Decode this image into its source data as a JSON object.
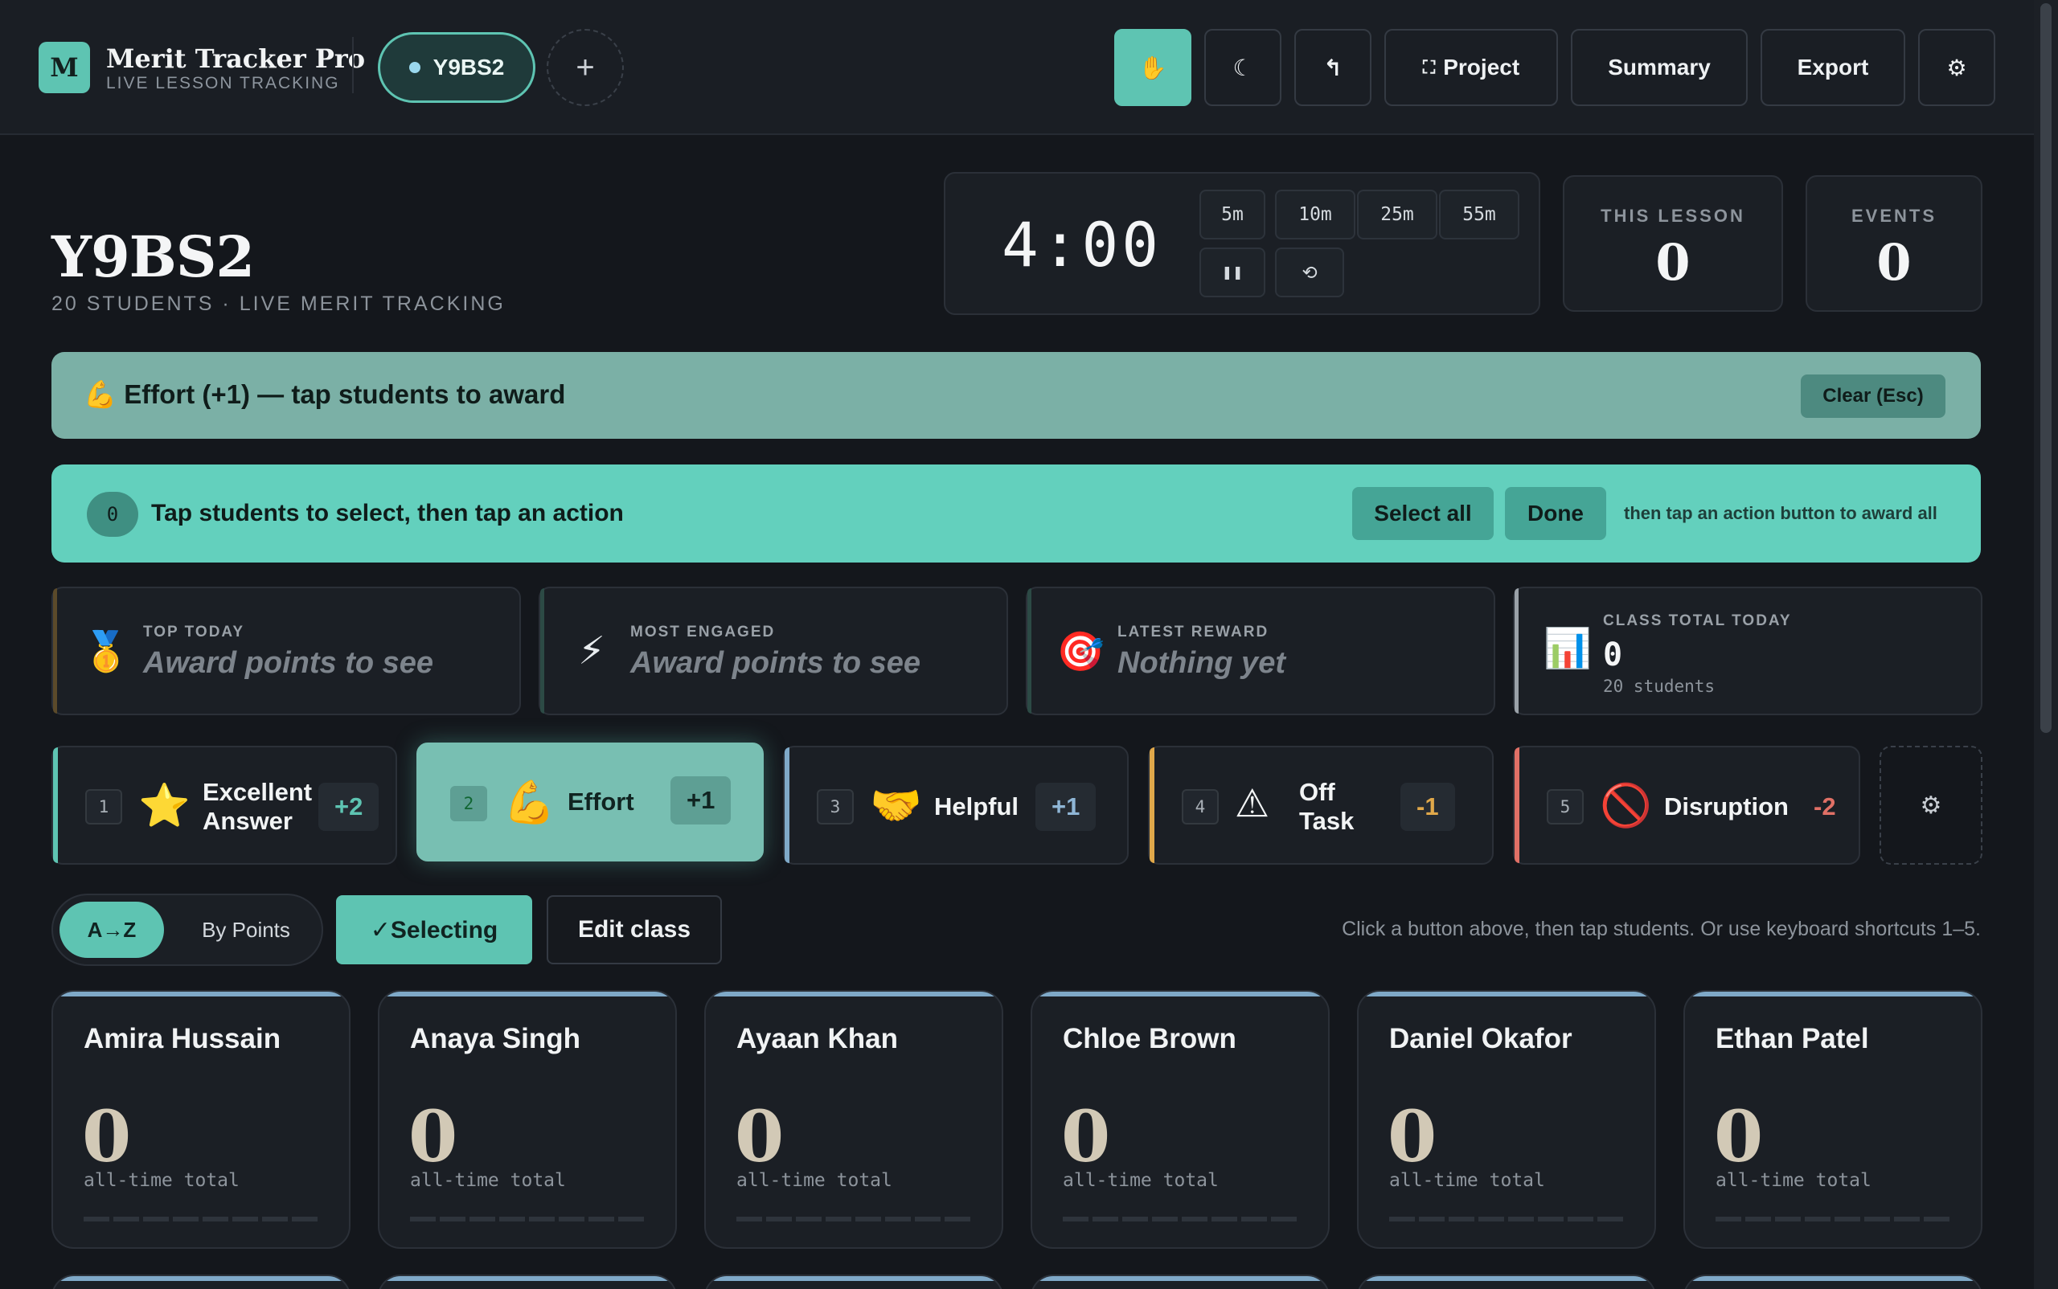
{
  "app": {
    "logo_letter": "M",
    "title": "Merit Tracker Pro",
    "subtitle": "LIVE LESSON TRACKING",
    "class_tab": "Y9BS2",
    "add_class_icon": "plus-icon"
  },
  "toolbar": {
    "hand_icon": "✋",
    "moon_icon": "☾",
    "undo_icon": "↰",
    "project_icon": "⛶",
    "project_label": "Project",
    "summary_label": "Summary",
    "export_label": "Export",
    "settings_icon": "⚙"
  },
  "heading": {
    "title": "Y9BS2",
    "subtitle": "20 STUDENTS · LIVE MERIT TRACKING"
  },
  "timer": {
    "display": "4:00",
    "presets": [
      "5m",
      "10m",
      "25m",
      "55m"
    ],
    "pause_icon": "❚❚",
    "reset_icon": "⟲"
  },
  "stats": {
    "this_lesson_label": "THIS LESSON",
    "this_lesson_value": "0",
    "events_label": "EVENTS",
    "events_value": "0"
  },
  "active_banner": {
    "text": "💪 Effort (+1) — tap students to award",
    "clear_label": "Clear (Esc)"
  },
  "select_banner": {
    "count": "0",
    "text": "Tap students to select, then tap an action",
    "select_all_label": "Select all",
    "done_label": "Done",
    "hint": "then tap an action button to award all"
  },
  "highlights": [
    {
      "icon": "🥇",
      "label": "TOP TODAY",
      "value": "Award points to see"
    },
    {
      "icon": "⚡",
      "label": "MOST ENGAGED",
      "value": "Award points to see"
    },
    {
      "icon": "🎯",
      "label": "LATEST REWARD",
      "value": "Nothing yet"
    },
    {
      "icon": "📊",
      "label": "CLASS TOTAL TODAY",
      "value": "0",
      "sub": "20 students"
    }
  ],
  "actions": [
    {
      "key": "1",
      "icon": "⭐",
      "label_line1": "Excellent",
      "label_line2": "Answer",
      "points": "+2",
      "color": "#5ec4b2"
    },
    {
      "key": "2",
      "icon": "💪",
      "label_line1": "Effort",
      "label_line2": "",
      "points": "+1",
      "color": "#5ec4b2"
    },
    {
      "key": "3",
      "icon": "🤝",
      "label_line1": "Helpful",
      "label_line2": "",
      "points": "+1",
      "color": "#7fa9c8"
    },
    {
      "key": "4",
      "icon": "⚠",
      "label_line1": "Off",
      "label_line2": "Task",
      "points": "-1",
      "color": "#e0a84a"
    },
    {
      "key": "5",
      "icon": "🚫",
      "label_line1": "Disruption",
      "label_line2": "",
      "points": "-2",
      "color": "#e07066"
    }
  ],
  "action_settings_icon": "⚙",
  "controls": {
    "sort_az": "A→Z",
    "sort_points": "By Points",
    "selecting_label": "✓Selecting",
    "edit_class_label": "Edit class",
    "hint": "Click a button above, then tap students. Or use keyboard shortcuts 1–5."
  },
  "students": [
    {
      "name": "Amira Hussain",
      "points": "0",
      "points_label": "all-time total"
    },
    {
      "name": "Anaya Singh",
      "points": "0",
      "points_label": "all-time total"
    },
    {
      "name": "Ayaan Khan",
      "points": "0",
      "points_label": "all-time total"
    },
    {
      "name": "Chloe Brown",
      "points": "0",
      "points_label": "all-time total"
    },
    {
      "name": "Daniel Okafor",
      "points": "0",
      "points_label": "all-time total"
    },
    {
      "name": "Ethan Patel",
      "points": "0",
      "points_label": "all-time total"
    }
  ]
}
